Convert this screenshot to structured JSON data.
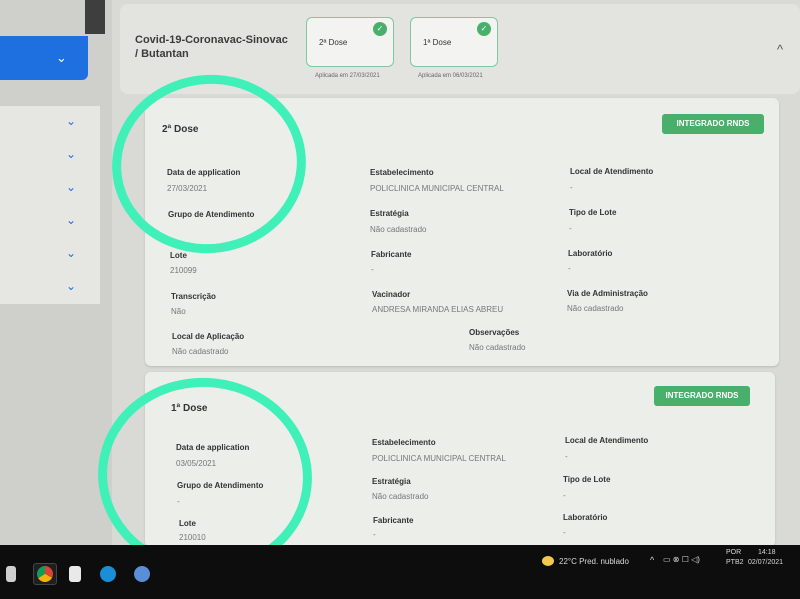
{
  "sidebar": {
    "chevron": "⌄"
  },
  "header": {
    "vaccine_name_line1": "Covid-19-Coronavac-Sinovac",
    "vaccine_name_line2": "/ Butantan",
    "dose_tabs": [
      {
        "label": "2ª Dose",
        "caption": "Aplicada em 27/03/2021"
      },
      {
        "label": "1ª Dose",
        "caption": "Aplicada em 06/03/2021"
      }
    ],
    "collapse_icon": "^"
  },
  "cards": [
    {
      "title": "2ª Dose",
      "badge": "INTEGRADO RNDS",
      "fields": {
        "data_label": "Data de application",
        "data_value": "27/03/2021",
        "estab_label": "Estabelecimento",
        "estab_value": "POLICLINICA MUNICIPAL CENTRAL",
        "local_label": "Local de Atendimento",
        "local_value": "-",
        "grupo_label": "Grupo de Atendimento",
        "grupo_value": "",
        "estrat_label": "Estratégia",
        "estrat_value": "Não cadastrado",
        "tipo_label": "Tipo de Lote",
        "tipo_value": "-",
        "lote_label": "Lote",
        "lote_value": "210099",
        "fab_label": "Fabricante",
        "fab_value": "-",
        "lab_label": "Laboratório",
        "lab_value": "-",
        "trans_label": "Transcrição",
        "trans_value": "Não",
        "vac_label": "Vacinador",
        "vac_value": "ANDRESA MIRANDA ELIAS ABREU",
        "via_label": "Via de Administração",
        "via_value": "Não cadastrado",
        "aplic_label": "Local de Aplicação",
        "aplic_value": "Não cadastrado",
        "obs_label": "Observações",
        "obs_value": "Não cadastrado"
      }
    },
    {
      "title": "1ª Dose",
      "badge": "INTEGRADO RNDS",
      "fields": {
        "data_label": "Data de application",
        "data_value": "03/05/2021",
        "estab_label": "Estabelecimento",
        "estab_value": "POLICLINICA MUNICIPAL CENTRAL",
        "local_label": "Local de Atendimento",
        "local_value": "-",
        "grupo_label": "Grupo de Atendimento",
        "grupo_value": "-",
        "estrat_label": "Estratégia",
        "estrat_value": "Não cadastrado",
        "tipo_label": "Tipo de Lote",
        "tipo_value": "-",
        "lote_label": "Lote",
        "lote_value": "210010",
        "fab_label": "Fabricante",
        "fab_value": "-",
        "lab_label": "Laboratório",
        "lab_value": "-"
      }
    }
  ],
  "taskbar": {
    "weather": "22°C  Pred. nublado",
    "lang_line1": "POR",
    "lang_line2": "PTB2",
    "time": "14:18",
    "date": "02/07/2021"
  },
  "colors": {
    "accent_blue": "#1e6fe0",
    "integrado_green": "#49b06c",
    "annotation_mint": "#3ff0b8"
  }
}
